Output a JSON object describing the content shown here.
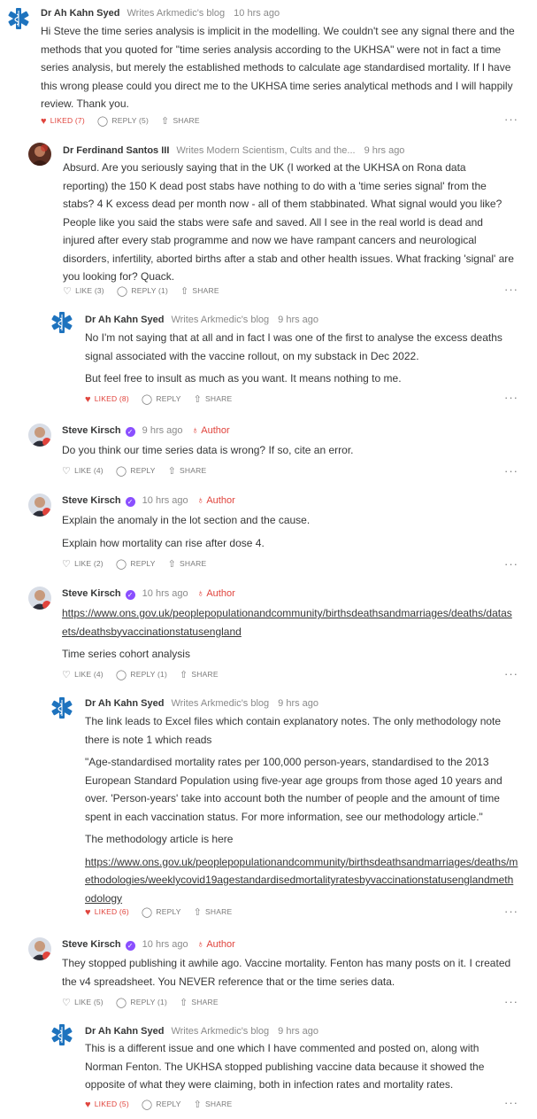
{
  "comments": [
    {
      "name": "Dr Ah Kahn Syed",
      "blog": "Writes Arkmedic's blog",
      "time": "10 hrs ago",
      "paragraphs": [
        "Hi Steve the time series analysis is implicit in the modelling. We couldn't see any signal there and the methods that you quoted for \"time series analysis according to the UKHSA\" were not in fact a time series analysis, but merely the established methods to calculate age standardised mortality. If I have this wrong please could you direct me to the UKHSA time series analytical methods and I will happily review. Thank you."
      ],
      "like_label": "LIKED (7)",
      "reply_label": "REPLY (5)",
      "share_label": "SHARE"
    },
    {
      "name": "Dr Ferdinand Santos III",
      "blog": "Writes Modern Scientism, Cults and the...",
      "time": "9 hrs ago",
      "paragraphs": [
        "Absurd. Are you seriously saying that in the UK (I worked at the UKHSA on Rona data reporting) the 150 K dead post stabs have nothing to do with a 'time series signal' from the stabs? 4 K excess dead per month now - all of them stabbinated. What signal would you like? People like you said the stabs were safe and saved. All I see in the real world is dead and injured after every stab programme and now we have rampant cancers and neurological disorders, infertility, aborted births after a stab and other health issues. What fracking 'signal' are you looking for? Quack."
      ],
      "like_label": "LIKE (3)",
      "reply_label": "REPLY (1)",
      "share_label": "SHARE"
    },
    {
      "name": "Dr Ah Kahn Syed",
      "blog": "Writes Arkmedic's blog",
      "time": "9 hrs ago",
      "paragraphs": [
        "No I'm not saying that at all and in fact I was one of the first to analyse the excess deaths signal associated with the vaccine rollout, on my substack in Dec 2022.",
        "But feel free to insult as much as you want. It means nothing to me."
      ],
      "like_label": "LIKED (8)",
      "reply_label": "REPLY",
      "share_label": "SHARE"
    },
    {
      "name": "Steve Kirsch",
      "time": "9 hrs ago",
      "author_label": "Author",
      "paragraphs": [
        "Do you think our time series data is wrong? If so, cite an error."
      ],
      "like_label": "LIKE (4)",
      "reply_label": "REPLY",
      "share_label": "SHARE"
    },
    {
      "name": "Steve Kirsch",
      "time": "10 hrs ago",
      "author_label": "Author",
      "paragraphs": [
        "Explain the anomaly in the lot section and the cause.",
        "Explain how mortality can rise after dose 4."
      ],
      "like_label": "LIKE (2)",
      "reply_label": "REPLY",
      "share_label": "SHARE"
    },
    {
      "name": "Steve Kirsch",
      "time": "10 hrs ago",
      "author_label": "Author",
      "link": "https://www.ons.gov.uk/peoplepopulationandcommunity/birthsdeathsandmarriages/deaths/datasets/deathsbyvaccinationstatusengland",
      "paragraphs": [
        "Time series cohort analysis"
      ],
      "like_label": "LIKE (4)",
      "reply_label": "REPLY (1)",
      "share_label": "SHARE"
    },
    {
      "name": "Dr Ah Kahn Syed",
      "blog": "Writes Arkmedic's blog",
      "time": "9 hrs ago",
      "paragraphs": [
        "The link leads to Excel files which contain explanatory notes. The only methodology note there is note 1 which reads",
        "\"Age-standardised mortality rates per 100,000 person-years, standardised to the 2013 European Standard Population using five-year age groups from those aged 10 years and over. 'Person-years' take into account both the number of people and the amount of time spent in each vaccination status. For more information, see our methodology article.\"",
        "The methodology article is here"
      ],
      "link": "https://www.ons.gov.uk/peoplepopulationandcommunity/birthsdeathsandmarriages/deaths/methodologies/weeklycovid19agestandardisedmortalityratesbyvaccinationstatusenglandmethodology",
      "like_label": "LIKED (6)",
      "reply_label": "REPLY",
      "share_label": "SHARE"
    },
    {
      "name": "Steve Kirsch",
      "time": "10 hrs ago",
      "author_label": "Author",
      "paragraphs": [
        "They stopped publishing it awhile ago. Vaccine mortality. Fenton has many posts on it. I created the v4 spreadsheet. You NEVER reference that or the time series data."
      ],
      "like_label": "LIKE (5)",
      "reply_label": "REPLY (1)",
      "share_label": "SHARE"
    },
    {
      "name": "Dr Ah Kahn Syed",
      "blog": "Writes Arkmedic's blog",
      "time": "9 hrs ago",
      "paragraphs": [
        "This is a different issue and one which I have commented and posted on, along with Norman Fenton. The UKHSA stopped publishing vaccine data because it showed the opposite of what they were claiming, both in infection rates and mortality rates."
      ],
      "like_label": "LIKED (5)",
      "reply_label": "REPLY",
      "share_label": "SHARE"
    }
  ],
  "colors": {
    "accent": "#e0443d",
    "verified": "#8a4fff",
    "medic": "#1e73be"
  }
}
